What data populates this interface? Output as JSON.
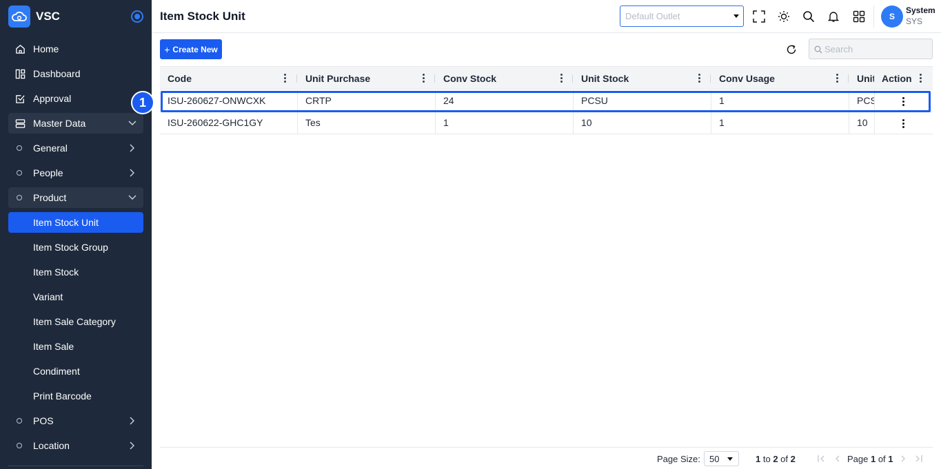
{
  "app": {
    "brand": "VSC",
    "page_title": "Item Stock Unit"
  },
  "sidebar": {
    "items": [
      {
        "label": "Home",
        "icon": "home-icon"
      },
      {
        "label": "Dashboard",
        "icon": "dashboard-icon"
      },
      {
        "label": "Approval",
        "icon": "approval-icon"
      },
      {
        "label": "Master Data",
        "icon": "database-icon",
        "expanded": true
      },
      {
        "label": "General",
        "icon": "circle-icon"
      },
      {
        "label": "People",
        "icon": "circle-icon"
      },
      {
        "label": "Product",
        "icon": "circle-icon",
        "expanded": true
      },
      {
        "label": "Item Stock Unit",
        "active": true
      },
      {
        "label": "Item Stock Group"
      },
      {
        "label": "Item Stock"
      },
      {
        "label": "Variant"
      },
      {
        "label": "Item Sale Category"
      },
      {
        "label": "Item Sale"
      },
      {
        "label": "Condiment"
      },
      {
        "label": "Print Barcode"
      },
      {
        "label": "POS",
        "icon": "circle-icon"
      },
      {
        "label": "Location",
        "icon": "circle-icon"
      }
    ]
  },
  "header": {
    "outlet_placeholder": "Default Outlet",
    "user": {
      "initial": "S",
      "name": "System",
      "code": "SYS"
    },
    "icons": [
      "fullscreen-icon",
      "theme-icon",
      "search-icon",
      "bell-icon",
      "apps-icon"
    ]
  },
  "toolbar": {
    "create_label": "Create New",
    "search_placeholder": "Search"
  },
  "table": {
    "columns": [
      "Code",
      "Unit Purchase",
      "Conv Stock",
      "Unit Stock",
      "Conv Usage",
      "Unit",
      "Action"
    ],
    "rows": [
      {
        "code": "ISU-260627-ONWCXK",
        "unit_purchase": "CRTP",
        "conv_stock": "24",
        "unit_stock": "PCSU",
        "conv_usage": "1",
        "unit": "PCS"
      },
      {
        "code": "ISU-260622-GHC1GY",
        "unit_purchase": "Tes",
        "conv_stock": "1",
        "unit_stock": "10",
        "conv_usage": "1",
        "unit": "10"
      }
    ]
  },
  "annotation": {
    "badge": "1"
  },
  "footer": {
    "page_size_label": "Page Size:",
    "page_size": "50",
    "range_from": "1",
    "range_to": "2",
    "range_of": "2",
    "page_current": "1",
    "page_total": "1"
  },
  "colors": {
    "sidebar_bg": "#1e2a3b",
    "accent": "#1a5cf0"
  }
}
